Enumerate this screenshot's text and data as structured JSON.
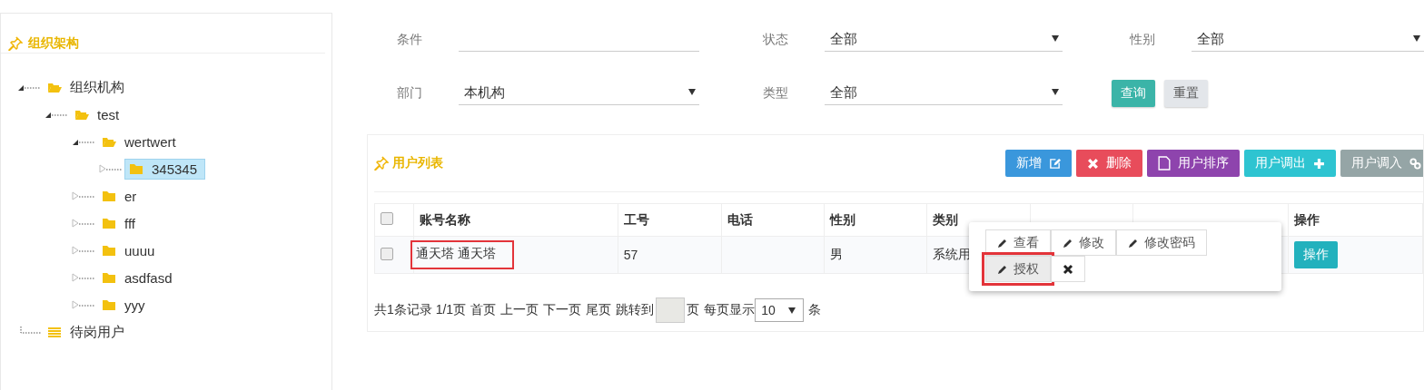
{
  "sidebar": {
    "title": "组织架构",
    "tree": [
      {
        "label": "组织机构",
        "kind": "folder",
        "expanded": true,
        "selected": false,
        "children": [
          {
            "label": "test",
            "kind": "folder",
            "expanded": true,
            "selected": false,
            "children": [
              {
                "label": "wertwert",
                "kind": "folder",
                "expanded": true,
                "selected": false,
                "children": [
                  {
                    "label": "345345",
                    "kind": "folder",
                    "expanded": false,
                    "selected": true
                  }
                ]
              },
              {
                "label": "er",
                "kind": "folder",
                "expanded": false,
                "selected": false
              },
              {
                "label": "fff",
                "kind": "folder",
                "expanded": false,
                "selected": false
              },
              {
                "label": "uuuu",
                "kind": "folder",
                "expanded": false,
                "selected": false
              },
              {
                "label": "asdfasd",
                "kind": "folder",
                "expanded": false,
                "selected": false
              },
              {
                "label": "yyy",
                "kind": "folder",
                "expanded": false,
                "selected": false
              }
            ]
          }
        ]
      },
      {
        "label": "待岗用户",
        "kind": "list",
        "selected": false
      }
    ]
  },
  "filters": [
    {
      "label": "条件",
      "kind": "text"
    },
    {
      "label": "状态",
      "kind": "select",
      "value": "全部"
    },
    {
      "label": "性别",
      "kind": "select",
      "value": "全部"
    },
    {
      "label": "部门",
      "kind": "select",
      "value": "本机构"
    },
    {
      "label": "类型",
      "kind": "select",
      "value": "全部"
    }
  ],
  "filter_buttons": [
    {
      "label": "查询",
      "color": "#3bb4a8"
    },
    {
      "label": "重置",
      "color": "#e3e6ea"
    }
  ],
  "user_list": {
    "title": "用户列表",
    "buttons": [
      {
        "label": "新增",
        "color": "#3a97dc"
      },
      {
        "label": "删除",
        "color": "#e84c5b"
      },
      {
        "label": "用户排序",
        "color": "#8e44ad"
      },
      {
        "label": "用户调出",
        "color": "#2ec4d1"
      },
      {
        "label": "用户调入",
        "color": "#95a5a6"
      }
    ],
    "select_all": {
      "checked": false
    },
    "columns": [
      "账号名称",
      "工号",
      "电话",
      "性别",
      "类别",
      "操作"
    ],
    "rows": [
      {
        "checked": false,
        "highlighted": true,
        "cells": [
          "通天塔 通天塔",
          "57",
          "",
          "男",
          "系统用",
          "",
          "",
          ""
        ],
        "action": "操作"
      }
    ],
    "action_menu": {
      "items": [
        {
          "label": "查看",
          "kind": "edit",
          "highlighted": false
        },
        {
          "label": "修改",
          "kind": "edit",
          "highlighted": false
        },
        {
          "label": "修改密码",
          "kind": "edit",
          "highlighted": false
        },
        {
          "label": "授权",
          "kind": "edit",
          "highlighted": true
        },
        {
          "kind": "close",
          "highlighted": false
        }
      ]
    },
    "pagination": {
      "summary": "共1条记录 1/1页",
      "first": "首页",
      "prev": "上一页",
      "next": "下一页",
      "last": "尾页",
      "jump_label": "跳转到",
      "page_unit": "页",
      "per_page_label": "每页显示",
      "per_page": "10",
      "per_page_unit": "条"
    }
  }
}
